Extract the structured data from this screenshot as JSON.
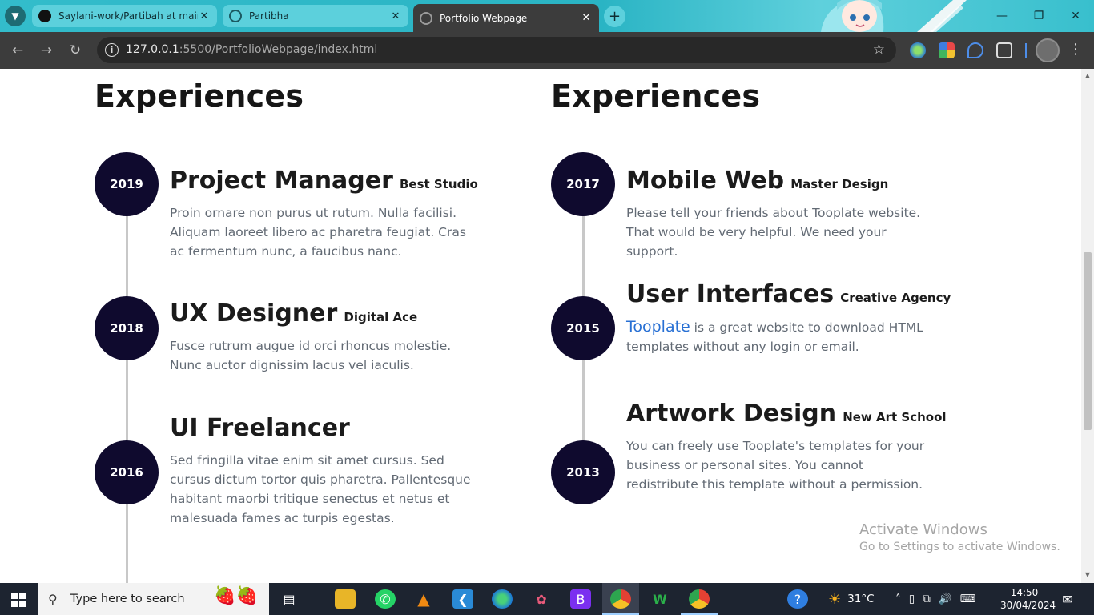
{
  "browser": {
    "tabs": [
      {
        "label": "Saylani-work/Partibah at main ·",
        "icon": "github-icon",
        "active": false
      },
      {
        "label": "Partibha",
        "icon": "globe-icon",
        "active": false
      },
      {
        "label": "Portfolio Webpage",
        "icon": "globe-icon",
        "active": true
      }
    ],
    "tab_close_glyph": "✕",
    "new_tab_glyph": "+",
    "url_host": "127.0.0.1",
    "url_path": ":5500/PortfolioWebpage/index.html"
  },
  "page": {
    "left_column": {
      "title": "Experiences",
      "items": [
        {
          "year": "2019",
          "role": "Project Manager",
          "company": "Best Studio",
          "description": "Proin ornare non purus ut rutum. Nulla facilisi. Aliquam laoreet libero ac pharetra feugiat. Cras ac fermentum nunc, a faucibus nanc."
        },
        {
          "year": "2018",
          "role": "UX Designer",
          "company": "Digital Ace",
          "description": "Fusce rutrum augue id orci rhoncus molestie. Nunc auctor dignissim lacus vel iaculis."
        },
        {
          "year": "2016",
          "role": "UI Freelancer",
          "company": "",
          "description": "Sed fringilla vitae enim sit amet cursus. Sed cursus dictum tortor quis pharetra. Pallentesque habitant maorbi tritique senectus et netus et malesuada fames ac turpis egestas."
        }
      ]
    },
    "right_column": {
      "title": "Experiences",
      "items": [
        {
          "year": "2017",
          "role": "Mobile Web",
          "company": "Master Design",
          "description": "Please tell your friends about Tooplate website. That would be very helpful. We need your support."
        },
        {
          "year": "2015",
          "role": "User Interfaces",
          "company": "Creative Agency",
          "link": "Tooplate",
          "description": " is a great website to download HTML templates without any login or email."
        },
        {
          "year": "2013",
          "role": "Artwork Design",
          "company": "New Art School",
          "description": "You can freely use Tooplate's templates for your business or personal sites. You cannot redistribute this template without a permission."
        }
      ]
    },
    "watermark": {
      "line1": "Activate Windows",
      "line2": "Go to Settings to activate Windows."
    }
  },
  "taskbar": {
    "search_placeholder": "Type here to search",
    "weather": "31°C",
    "time": "14:50",
    "date": "30/04/2024"
  },
  "colors": {
    "year_circle": "#0f0a2e",
    "link": "#2870d4",
    "tab_strip": "#33bccb",
    "toolbar": "#3c3c3c"
  }
}
